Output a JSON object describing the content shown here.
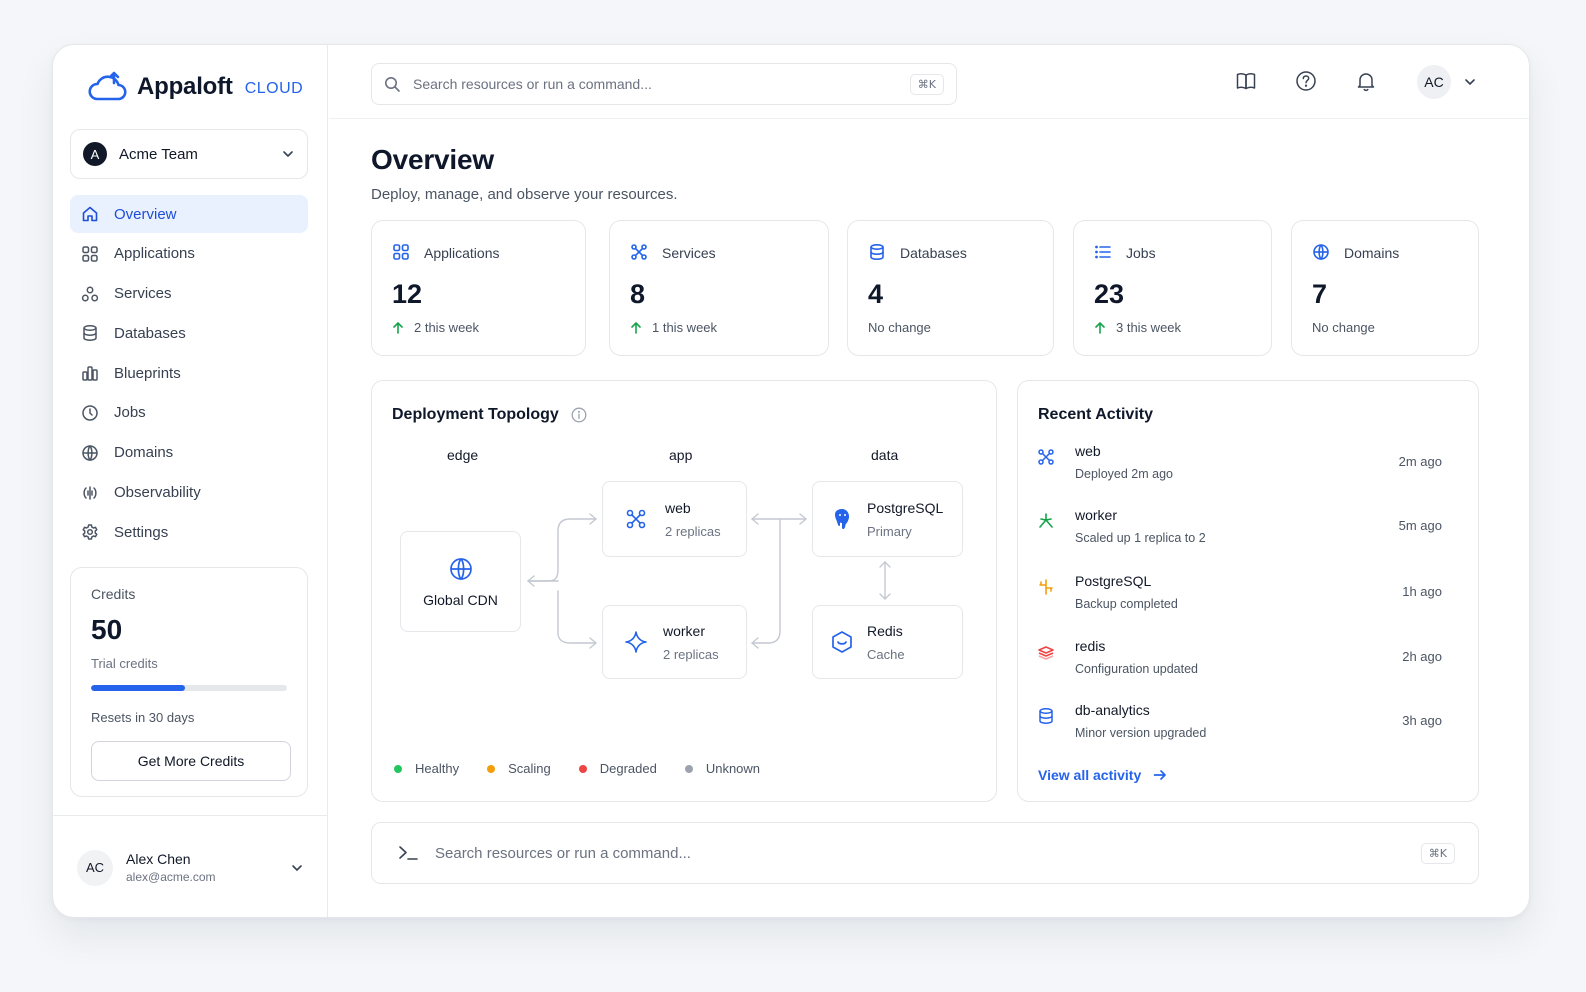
{
  "brand": {
    "name": "Appaloft",
    "tag": "CLOUD",
    "color": "#2563eb"
  },
  "team": {
    "initial": "A",
    "name": "Acme Team"
  },
  "nav": [
    {
      "label": "Overview",
      "icon": "home-icon",
      "active": true
    },
    {
      "label": "Applications",
      "icon": "apps-icon"
    },
    {
      "label": "Services",
      "icon": "services-icon"
    },
    {
      "label": "Databases",
      "icon": "database-icon"
    },
    {
      "label": "Blueprints",
      "icon": "blueprints-icon"
    },
    {
      "label": "Jobs",
      "icon": "jobs-icon"
    },
    {
      "label": "Domains",
      "icon": "globe-icon"
    },
    {
      "label": "Observability",
      "icon": "observability-icon"
    },
    {
      "label": "Settings",
      "icon": "gear-icon"
    }
  ],
  "credits": {
    "label": "Credits",
    "value": "50",
    "sub": "Trial credits",
    "progress_percent": 48,
    "reset": "Resets in 30 days",
    "button": "Get More Credits"
  },
  "user": {
    "initials": "AC",
    "name": "Alex Chen",
    "email": "alex@acme.com"
  },
  "search": {
    "placeholder": "Search resources or run a command...",
    "shortcut": "⌘K"
  },
  "topbar": {
    "avatar": "AC"
  },
  "page": {
    "title": "Overview",
    "subtitle": "Deploy, manage, and observe your resources."
  },
  "stats": [
    {
      "label": "Applications",
      "icon": "apps-icon",
      "value": "12",
      "delta": "2 this week",
      "up": true
    },
    {
      "label": "Services",
      "icon": "services-icon",
      "value": "8",
      "delta": "1 this week",
      "up": true
    },
    {
      "label": "Databases",
      "icon": "database-icon",
      "value": "4",
      "delta": "No change",
      "up": false
    },
    {
      "label": "Jobs",
      "icon": "list-icon",
      "value": "23",
      "delta": "3 this week",
      "up": true
    },
    {
      "label": "Domains",
      "icon": "globe-icon",
      "value": "7",
      "delta": "No change",
      "up": false
    }
  ],
  "topology": {
    "title": "Deployment Topology",
    "lanes": [
      "edge",
      "app",
      "data"
    ],
    "nodes": {
      "cdn": {
        "name": "Global CDN"
      },
      "web": {
        "name": "web",
        "sub": "2 replicas"
      },
      "worker": {
        "name": "worker",
        "sub": "2 replicas"
      },
      "postgres": {
        "name": "PostgreSQL",
        "sub": "Primary"
      },
      "redis": {
        "name": "Redis",
        "sub": "Cache"
      }
    },
    "legend": [
      {
        "label": "Healthy",
        "color": "#22c55e"
      },
      {
        "label": "Scaling",
        "color": "#f59e0b"
      },
      {
        "label": "Degraded",
        "color": "#ef4444"
      },
      {
        "label": "Unknown",
        "color": "#9ca3af"
      }
    ]
  },
  "activity": {
    "title": "Recent Activity",
    "items": [
      {
        "name": "web",
        "desc": "Deployed  2m ago",
        "time": "2m ago",
        "icon": "service-icon",
        "color": "#2563eb"
      },
      {
        "name": "worker",
        "desc": "Scaled up 1 replica to 2",
        "time": "5m ago",
        "icon": "worker-icon",
        "color": "#16a34a"
      },
      {
        "name": "PostgreSQL",
        "desc": "Backup completed",
        "time": "1h ago",
        "icon": "postgres-icon",
        "color": "#f59e0b"
      },
      {
        "name": "redis",
        "desc": "Configuration updated",
        "time": "2h ago",
        "icon": "redis-icon",
        "color": "#ef4444"
      },
      {
        "name": "db-analytics",
        "desc": "Minor version upgraded",
        "time": "3h ago",
        "icon": "database-icon",
        "color": "#2563eb"
      }
    ],
    "view_all": "View all activity"
  },
  "command": {
    "placeholder": "Search resources or run a command...",
    "shortcut": "⌘K"
  }
}
